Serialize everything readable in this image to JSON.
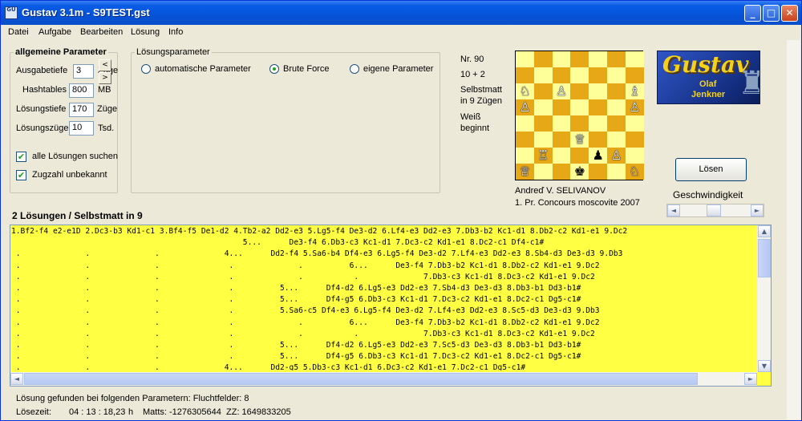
{
  "window": {
    "title": "Gustav 3.1m - S9TEST.gst",
    "icon_text": "GU"
  },
  "menu": [
    "Datei",
    "Aufgabe",
    "Bearbeiten",
    "Lösung",
    "Info"
  ],
  "general": {
    "legend": "allgemeine Parameter",
    "ausgabetiefe_label": "Ausgabetiefe",
    "ausgabetiefe_value": "3",
    "ausgabetiefe_unit": "Züge",
    "hashtables_label": "Hashtables",
    "hashtables_value": "800",
    "hashtables_unit": "MB",
    "loesungstiefe_label": "Lösungstiefe",
    "loesungstiefe_value": "170",
    "loesungstiefe_unit": "Züge",
    "loesungszuege_label": "Lösungszüge",
    "loesungszuege_value": "10",
    "loesungszuege_unit": "Tsd.",
    "all_solutions": "alle Lösungen suchen",
    "unknown_moves": "Zugzahl unbekannt"
  },
  "solution_params": {
    "legend": "Lösungsparameter",
    "options": [
      "automatische Parameter",
      "Brute Force",
      "eigene Parameter"
    ],
    "selected": "Brute Force"
  },
  "problem": {
    "nr": "Nr. 90",
    "count": "10 + 2",
    "stip1": "Selbstmatt",
    "stip2": "in 9 Zügen",
    "turn1": "Weiß",
    "turn2": "beginnt",
    "author": "Andreď V. SELIVANOV",
    "source": "1. Pr. Concours moscovite 2007"
  },
  "logo": {
    "title": "Gustav",
    "name1": "Olaf",
    "name2": "Jenkner"
  },
  "solve_button": "Lösen",
  "speed_label": "Geschwindigkeit",
  "speed_level": 0.46,
  "results_heading": "2 Lösungen / Selbstmatt in 9",
  "results": [
    "1.Bf2-f4 e2-e1D 2.Dc3-b3 Kd1-c1 3.Bf4-f5 De1-d2 4.Tb2-a2 Dd2-e3 5.Lg5-f4 De3-d2 6.Lf4-e3 Dd2-e3 7.Db3-b2 Kc1-d1 8.Db2-c2 Kd1-e1 9.Dc2",
    "                                                  5...      De3-f4 6.Db3-c3 Kc1-d1 7.Dc3-c2 Kd1-e1 8.Dc2-c1 Df4-c1#",
    " .              .              .              4...      Dd2-f4 5.Sa6-b4 Df4-e3 6.Lg5-f4 De3-d2 7.Lf4-e3 Dd2-e3 8.Sb4-d3 De3-d3 9.Db3",
    " .              .              .               .              .          6...      De3-f4 7.Db3-b2 Kc1-d1 8.Db2-c2 Kd1-e1 9.Dc2",
    " .              .              .               .              .           .              7.Db3-c3 Kc1-d1 8.Dc3-c2 Kd1-e1 9.Dc2",
    " .              .              .               .          5...      Df4-d2 6.Lg5-e3 Dd2-e3 7.Sb4-d3 De3-d3 8.Db3-b1 Dd3-b1#",
    " .              .              .               .          5...      Df4-g5 6.Db3-c3 Kc1-d1 7.Dc3-c2 Kd1-e1 8.Dc2-c1 Dg5-c1#",
    " .              .              .               .          5.Sa6-c5 Df4-e3 6.Lg5-f4 De3-d2 7.Lf4-e3 Dd2-e3 8.Sc5-d3 De3-d3 9.Db3",
    " .              .              .               .              .          6...      De3-f4 7.Db3-b2 Kc1-d1 8.Db2-c2 Kd1-e1 9.Dc2",
    " .              .              .               .              .           .              7.Db3-c3 Kc1-d1 8.Dc3-c2 Kd1-e1 9.Dc2",
    " .              .              .               .          5...      Df4-d2 6.Lg5-e3 Dd2-e3 7.Sc5-d3 De3-d3 8.Db3-b1 Dd3-b1#",
    " .              .              .               .          5...      Df4-g5 6.Db3-c3 Kc1-d1 7.Dc3-c2 Kd1-e1 8.Dc2-c1 Dg5-c1#",
    " .              .              .              4...      Dd2-g5 5.Db3-c3 Kc1-d1 6.Dc3-c2 Kd1-e1 7.Dc2-c1 Dg5-c1#"
  ],
  "status1": "Lösung gefunden bei folgenden Parametern: Fluchtfelder: 8",
  "status2_label": "Lösezeit:",
  "status2_time": "04 : 13 : 18,23",
  "status2_h": "h",
  "status2_matts": "Matts: -1276305644",
  "status2_zz": "ZZ: 1649833205"
}
